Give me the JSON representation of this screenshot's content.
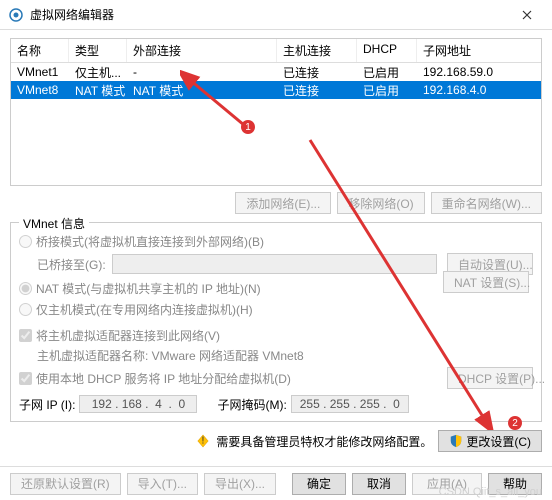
{
  "window": {
    "title": "虚拟网络编辑器"
  },
  "table": {
    "headers": {
      "name": "名称",
      "type": "类型",
      "ext": "外部连接",
      "host": "主机连接",
      "dhcp": "DHCP",
      "subnet": "子网地址"
    },
    "rows": [
      {
        "name": "VMnet1",
        "type": "仅主机...",
        "ext": "-",
        "host": "已连接",
        "dhcp": "已启用",
        "subnet": "192.168.59.0",
        "selected": false
      },
      {
        "name": "VMnet8",
        "type": "NAT 模式",
        "ext": "NAT 模式",
        "host": "已连接",
        "dhcp": "已启用",
        "subnet": "192.168.4.0",
        "selected": true
      }
    ]
  },
  "table_buttons": {
    "add": "添加网络(E)...",
    "remove": "移除网络(O)",
    "rename": "重命名网络(W)..."
  },
  "group": {
    "title": "VMnet 信息",
    "bridge": {
      "label": "桥接模式(将虚拟机直接连接到外部网络)(B)",
      "sublabel": "已桥接至(G):",
      "auto_btn": "自动设置(U)..."
    },
    "nat": {
      "label": "NAT 模式(与虚拟机共享主机的 IP 地址)(N)",
      "btn": "NAT 设置(S)..."
    },
    "hostonly": {
      "label": "仅主机模式(在专用网络内连接虚拟机)(H)"
    },
    "connect_host": {
      "label": "将主机虚拟适配器连接到此网络(V)",
      "subtext": "主机虚拟适配器名称: VMware 网络适配器 VMnet8"
    },
    "dhcp": {
      "label": "使用本地 DHCP 服务将 IP 地址分配给虚拟机(D)",
      "btn": "DHCP 设置(P)..."
    },
    "subnet_ip": {
      "label": "子网 IP (I):",
      "value": "192 . 168 .  4  .  0"
    },
    "subnet_mask": {
      "label": "子网掩码(M):",
      "value": "255 . 255 . 255 .  0"
    }
  },
  "admin": {
    "warn": "需要具备管理员特权才能修改网络配置。",
    "change_btn": "更改设置(C)"
  },
  "footer": {
    "restore": "还原默认设置(R)",
    "import": "导入(T)...",
    "export": "导出(X)...",
    "ok": "确定",
    "cancel": "取消",
    "apply": "应用(A)",
    "help": "帮助"
  },
  "annotations": {
    "badge1": "1",
    "badge2": "2"
  },
  "watermark": "CSDN Qiit_s_all_you"
}
